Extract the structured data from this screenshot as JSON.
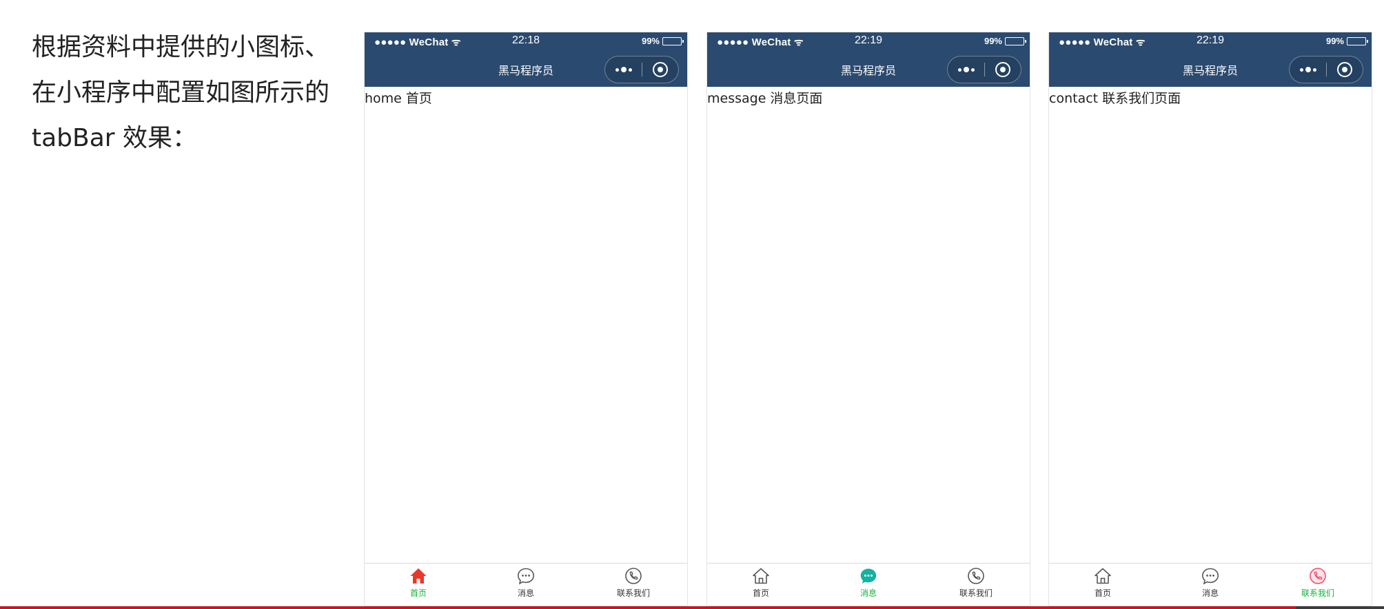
{
  "instruction": {
    "line1": "根据资料中提供的小图标、",
    "line2": "在小程序中配置如图所示的",
    "line3": "tabBar 效果："
  },
  "colors": {
    "navbar_bg": "#2b4a6f",
    "tab_active_text": "#13b13b",
    "home_active_icon": "#e8382a",
    "message_active_icon": "#13b2a2",
    "contact_active_icon": "#f0506e",
    "tab_inactive_icon": "#555555",
    "slide_bottom_bar": "#c9151e"
  },
  "phones": [
    {
      "status": {
        "carrier": "●●●●● WeChat",
        "time": "22:18",
        "battery": "99%"
      },
      "nav_title": "黑马程序员",
      "content": "home 首页",
      "tabs": [
        {
          "label": "首页",
          "icon": "home-icon",
          "active": true
        },
        {
          "label": "消息",
          "icon": "message-icon",
          "active": false
        },
        {
          "label": "联系我们",
          "icon": "contact-phone-icon",
          "active": false
        }
      ]
    },
    {
      "status": {
        "carrier": "●●●●● WeChat",
        "time": "22:19",
        "battery": "99%"
      },
      "nav_title": "黑马程序员",
      "content": "message 消息页面",
      "tabs": [
        {
          "label": "首页",
          "icon": "home-icon",
          "active": false
        },
        {
          "label": "消息",
          "icon": "message-icon",
          "active": true
        },
        {
          "label": "联系我们",
          "icon": "contact-phone-icon",
          "active": false
        }
      ]
    },
    {
      "status": {
        "carrier": "●●●●● WeChat",
        "time": "22:19",
        "battery": "99%"
      },
      "nav_title": "黑马程序员",
      "content": "contact 联系我们页面",
      "tabs": [
        {
          "label": "首页",
          "icon": "home-icon",
          "active": false
        },
        {
          "label": "消息",
          "icon": "message-icon",
          "active": false
        },
        {
          "label": "联系我们",
          "icon": "contact-phone-icon",
          "active": true
        }
      ]
    }
  ]
}
